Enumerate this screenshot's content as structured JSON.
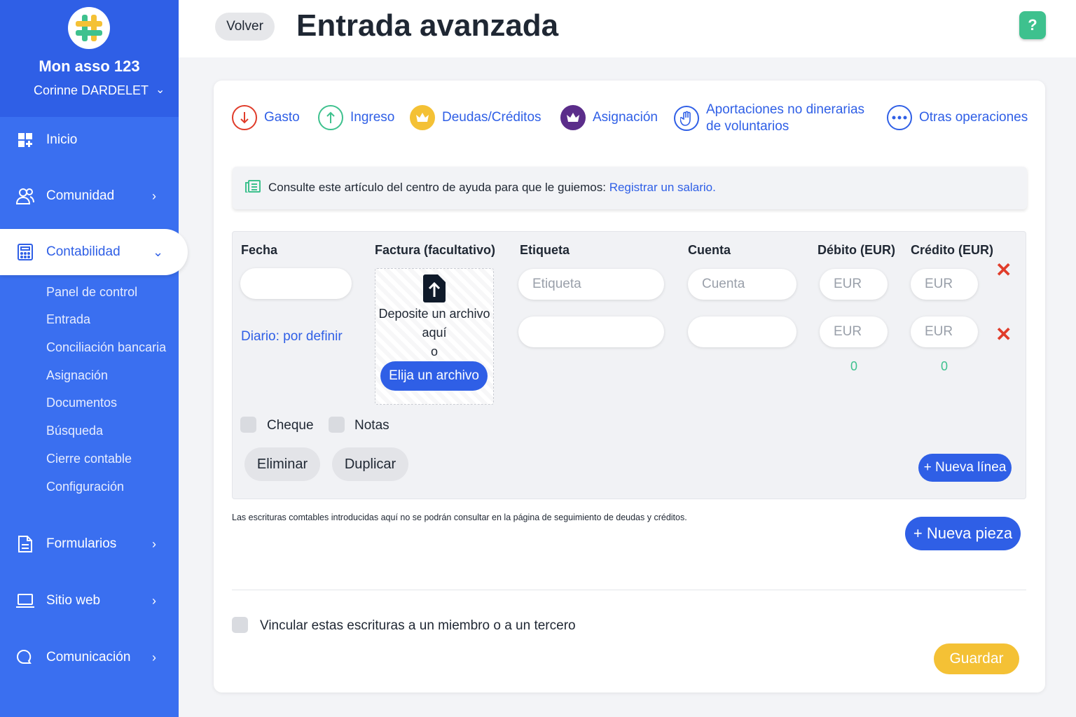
{
  "sidebar": {
    "org_name": "Mon asso 123",
    "user_name": "Corinne DARDELET",
    "items": {
      "inicio": "Inicio",
      "comunidad": "Comunidad",
      "contabilidad": "Contabilidad",
      "formularios": "Formularios",
      "sitio_web": "Sitio web",
      "comunicacion": "Comunicación"
    },
    "sub_items": [
      "Panel de control",
      "Entrada",
      "Conciliación bancaria",
      "Asignación",
      "Documentos",
      "Búsqueda",
      "Cierre contable",
      "Configuración"
    ]
  },
  "header": {
    "back_label": "Volver",
    "title": "Entrada avanzada",
    "help_label": "?"
  },
  "op_types": [
    "Gasto",
    "Ingreso",
    "Deudas/Créditos",
    "Asignación",
    "Aportaciones no dinerarias",
    "de voluntarios",
    "Otras operaciones"
  ],
  "help_box": {
    "text": "Consulte este artículo del centro de ayuda para que le guiemos: ",
    "link": "Registrar un salario."
  },
  "entry": {
    "columns": [
      "Fecha",
      "Factura (facultativo)",
      "Etiqueta",
      "Cuenta",
      "Débito (EUR)",
      "Crédito (EUR)"
    ],
    "placeholders": {
      "etiqueta": "Etiqueta",
      "cuenta": "Cuenta",
      "eur": "EUR"
    },
    "dropzone_line1": "Deposite un archivo",
    "dropzone_line2": "aquí",
    "dropzone_line3": "o",
    "choose_file": "Elija un archivo",
    "diario": "Diario: por definir",
    "debit_total": "0",
    "credit_total": "0",
    "cheque_label": "Cheque",
    "notas_label": "Notas",
    "delete_label": "Eliminar",
    "duplicate_label": "Duplicar",
    "new_line": "+ Nueva línea"
  },
  "note": "Las escrituras comtables introducidas aquí no se podrán consultar en la página de seguimiento de deudas y créditos.",
  "new_piece": "+ Nueva pieza",
  "link_label": "Vincular estas escrituras a un miembro o a un tercero",
  "save_label": "Guardar",
  "colors": {
    "primary": "#2f5fe6",
    "sidebar": "#3a6ff0",
    "success": "#3ec18e",
    "danger": "#e03c2a",
    "warning": "#f4c135"
  }
}
